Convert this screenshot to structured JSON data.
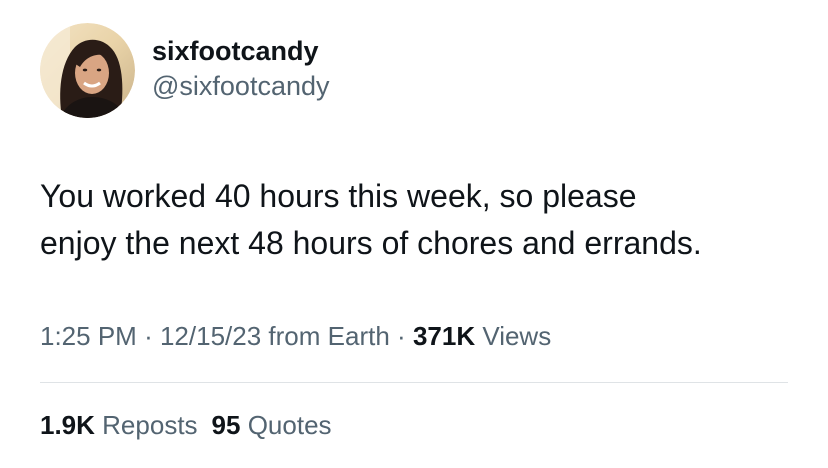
{
  "user": {
    "display_name": "sixfootcandy",
    "handle": "@sixfootcandy",
    "avatar_icon": "profile-photo"
  },
  "tweet": {
    "text_line1": "You worked 40 hours this week, so please",
    "text_line2": "enjoy the next 48 hours of chores and errands."
  },
  "meta": {
    "time": "1:25 PM",
    "separator": "·",
    "date": "12/15/23",
    "source": "from Earth",
    "views_count": "371K",
    "views_label": "Views"
  },
  "stats": {
    "reposts_count": "1.9K",
    "reposts_label": "Reposts",
    "quotes_count": "95",
    "quotes_label": "Quotes"
  },
  "colors": {
    "text_primary": "#0f1419",
    "text_secondary": "#536471",
    "divider": "#dfe3e6"
  }
}
